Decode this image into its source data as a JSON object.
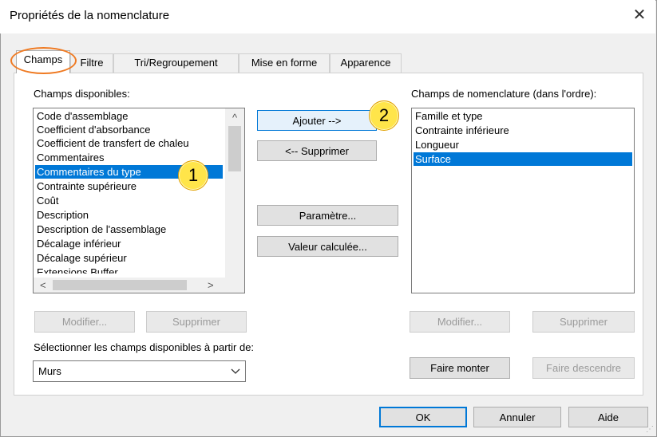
{
  "window": {
    "title": "Propriétés de la nomenclature",
    "close_icon": "close-icon"
  },
  "tabs": [
    {
      "label": "Champs",
      "active": true
    },
    {
      "label": "Filtre",
      "active": false
    },
    {
      "label": "Tri/Regroupement",
      "active": false
    },
    {
      "label": "Mise en forme",
      "active": false
    },
    {
      "label": "Apparence",
      "active": false
    }
  ],
  "available": {
    "label": "Champs disponibles:",
    "items": [
      "Code d'assemblage",
      "Coefficient d'absorbance",
      "Coefficient de transfert de chaleu",
      "Commentaires",
      "Commentaires du type",
      "Contrainte supérieure",
      "Coût",
      "Description",
      "Description de l'assemblage",
      "Décalage inférieur",
      "Décalage supérieur",
      "Extensions Buffer"
    ],
    "selected": "Commentaires du type",
    "scroll_up_glyph": "^",
    "scroll_left_glyph": "<",
    "scroll_right_glyph": ">"
  },
  "middle_buttons": {
    "add": "Ajouter -->",
    "remove": "<-- Supprimer",
    "parameter": "Paramètre...",
    "calculated": "Valeur calculée..."
  },
  "schedule_fields": {
    "label": "Champs de nomenclature (dans l'ordre):",
    "items": [
      "Famille et type",
      "Contrainte inférieure",
      "Longueur",
      "Surface"
    ],
    "selected": "Surface"
  },
  "left_buttons": {
    "edit": "Modifier...",
    "delete": "Supprimer"
  },
  "right_buttons": {
    "edit": "Modifier...",
    "delete": "Supprimer",
    "move_up": "Faire monter",
    "move_down": "Faire descendre"
  },
  "select_from": {
    "label": "Sélectionner les champs disponibles à partir de:",
    "value": "Murs"
  },
  "footer": {
    "ok": "OK",
    "cancel": "Annuler",
    "help": "Aide"
  },
  "annotations": {
    "badge1": "1",
    "badge2": "2",
    "badge_color": "#ffe54a",
    "ring_color": "#ef7a22"
  },
  "colors": {
    "selection": "#0078d7",
    "dialog_bg": "#f0f0f0"
  }
}
